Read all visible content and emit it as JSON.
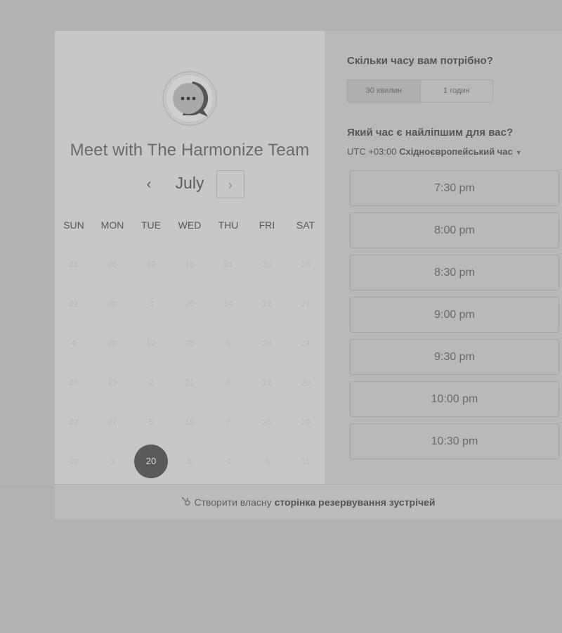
{
  "header": {
    "title": "Meet with The Harmonize Team"
  },
  "calendar": {
    "month": "July",
    "prev_icon": "‹",
    "next_icon": "›",
    "weekdays": [
      "SUN",
      "MON",
      "TUE",
      "WED",
      "THU",
      "FRI",
      "SAT"
    ],
    "weeks": [
      [
        "28",
        "25",
        "19",
        "16",
        "31",
        "30",
        "16"
      ],
      [
        "21",
        "30",
        "3",
        "20",
        "14",
        "12",
        "21"
      ],
      [
        "4",
        "20",
        "12",
        "28",
        "6",
        "28",
        "24"
      ],
      [
        "26",
        "13",
        "2",
        "21",
        "8",
        "12",
        "20"
      ],
      [
        "22",
        "27",
        "6",
        "15",
        "7",
        "25",
        "19"
      ],
      [
        "12",
        "3",
        "20",
        "6",
        "4",
        "3",
        "11"
      ]
    ],
    "selected_day": "20"
  },
  "duration": {
    "question": "Скільки часу вам потрібно?",
    "options": [
      "30 хвилин",
      "1 годин"
    ],
    "selected": "30 хвилин"
  },
  "time": {
    "question": "Який час є найліпшим для вас?",
    "timezone_offset": "UTC +03:00",
    "timezone_name": "Східноєвропейський час",
    "slots": [
      "7:30 pm",
      "8:00 pm",
      "8:30 pm",
      "9:00 pm",
      "9:30 pm",
      "10:00 pm",
      "10:30 pm"
    ]
  },
  "footer": {
    "prefix": "Створити власну",
    "brand_text": "сторінка резервування зустрічей"
  },
  "colors": {
    "selected_day_bg": "#5a5a5a",
    "left_panel_bg": "#c7c7c7",
    "right_panel_bg": "#b9b9b9"
  },
  "icons": {
    "logo": "chat-bubble-logo-icon",
    "timezone_caret": "caret-down-icon",
    "footer_sprocket": "sprocket-icon"
  }
}
